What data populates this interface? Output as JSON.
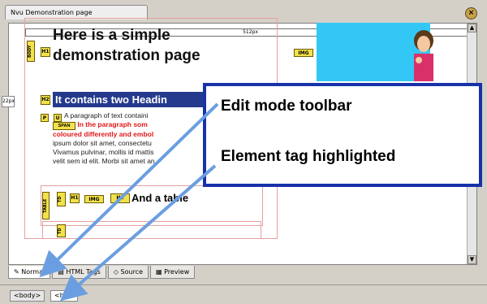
{
  "window": {
    "tab_title": "Nvu Demonstration page",
    "close_icon": "close-icon",
    "ruler_label": "512px",
    "left_marker": "22px"
  },
  "document": {
    "heading1": "Here is a simple demonstration page",
    "heading2": "It contains two Headin",
    "para_line1": "A paragraph of text containi",
    "para_span": "In the paragraph som",
    "para_red2": "coloured differently and embol",
    "para_line3": "ipsum dolor sit amet, consectetu",
    "para_line4": "Vivamus pulvinar, mollis id mattis",
    "para_line5": "velit sem id elit. Morbi sit amet an",
    "table_heading": "And a table"
  },
  "tags": {
    "body": "BODY",
    "h1": "H1",
    "h2": "H2",
    "p": "P",
    "u": "U",
    "span": "SPAN",
    "table": "TABLE",
    "td": "TD",
    "img": "IMG",
    "h1b": "H1"
  },
  "callout": {
    "line1": "Edit mode toolbar",
    "line2": "Element tag highlighted"
  },
  "edit_tabs": [
    {
      "label": "Normal",
      "icon": "pencil-icon"
    },
    {
      "label": "HTML Tags",
      "icon": "tags-icon"
    },
    {
      "label": "Source",
      "icon": "source-icon"
    },
    {
      "label": "Preview",
      "icon": "preview-icon"
    }
  ],
  "status": {
    "crumbs": [
      "<body>",
      "<h2>"
    ]
  },
  "colors": {
    "tag_yellow": "#f2e24a",
    "heading_bg": "#243a8c",
    "callout_border": "#1832a8",
    "image_bg": "#33c7f5",
    "arrow": "#6b9ee0"
  }
}
